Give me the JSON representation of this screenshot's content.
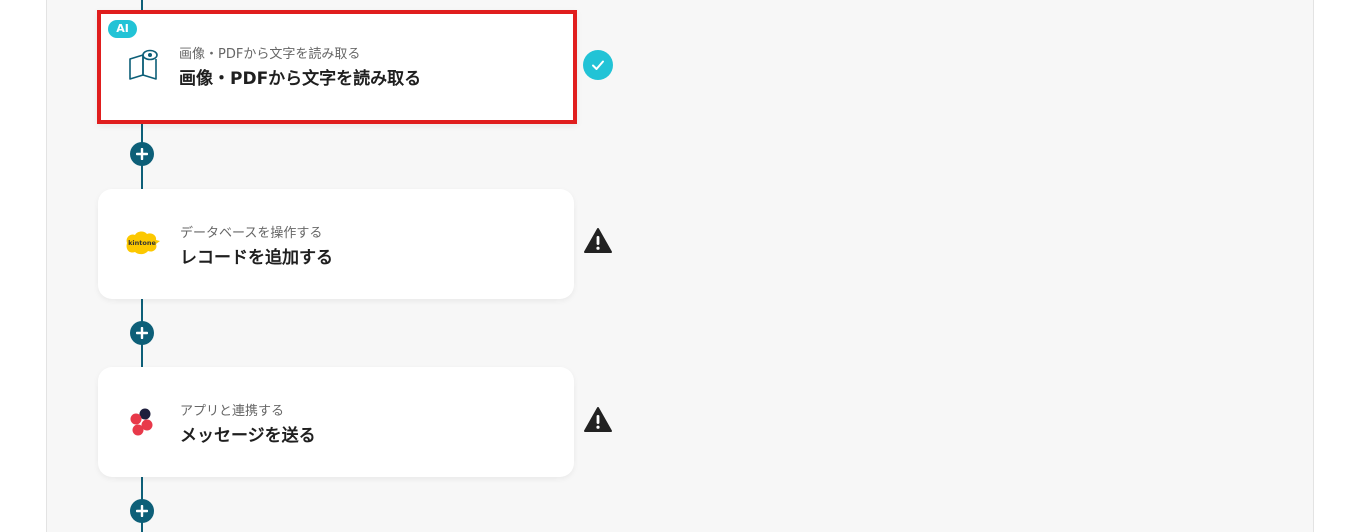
{
  "steps": [
    {
      "badge": "AI",
      "subtitle": "画像・PDFから文字を読み取る",
      "title": "画像・PDFから文字を読み取る",
      "icon": "book-eye-icon",
      "status": "complete",
      "selected": true
    },
    {
      "subtitle": "データベースを操作する",
      "title": "レコードを追加する",
      "icon": "kintone-logo",
      "logo_text": "kintone",
      "status": "warning"
    },
    {
      "subtitle": "アプリと連携する",
      "title": "メッセージを送る",
      "icon": "slack-like-app-icon",
      "status": "warning"
    }
  ],
  "colors": {
    "flow_line": "#0d5f78",
    "highlight_border": "#e01e1e",
    "check": "#22c3d6",
    "ai_badge": "#22c3d6",
    "warning": "#222222"
  }
}
